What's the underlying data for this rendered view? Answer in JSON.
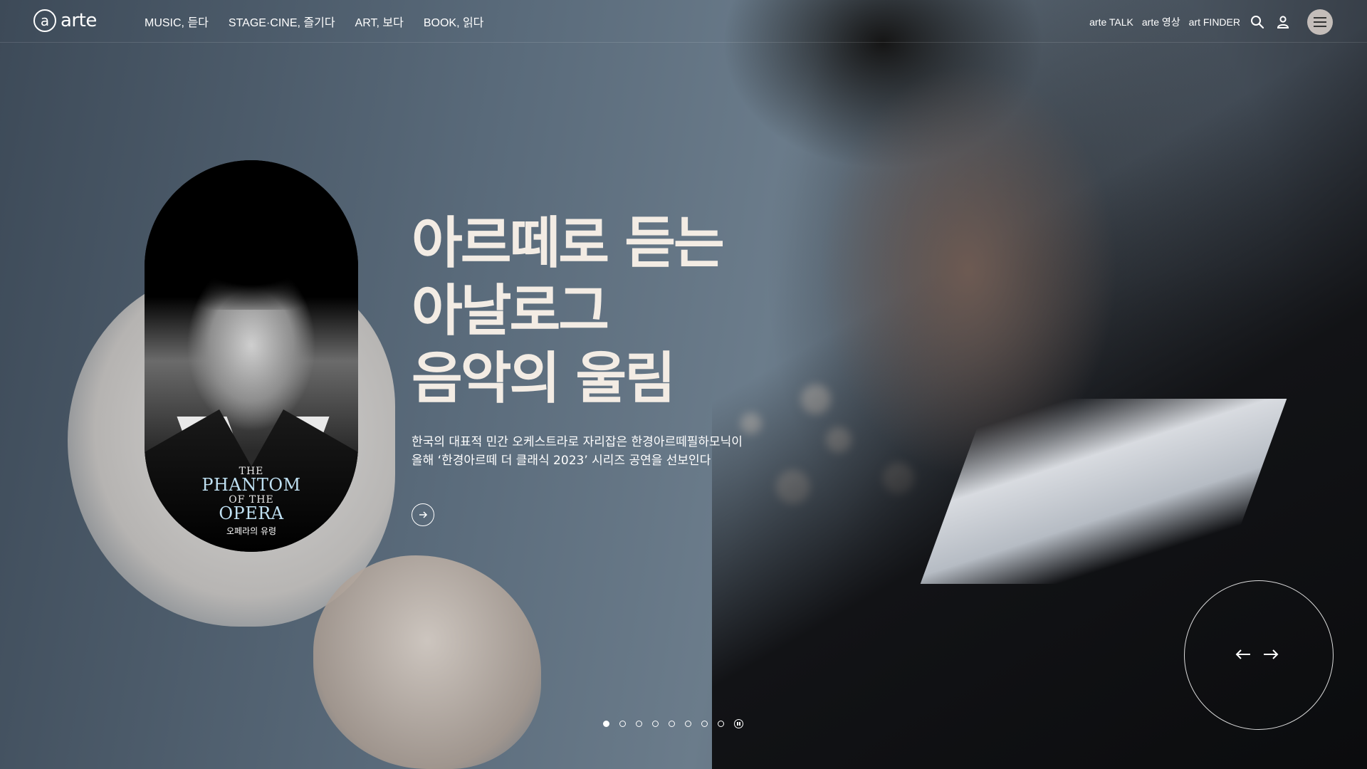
{
  "header": {
    "logo": {
      "mark": "a",
      "text": "arte"
    },
    "nav": [
      {
        "label": "MUSIC, 듣다"
      },
      {
        "label": "STAGE·CINE, 즐기다"
      },
      {
        "label": "ART, 보다"
      },
      {
        "label": "BOOK, 읽다"
      }
    ],
    "utility": [
      {
        "label": "arte TALK"
      },
      {
        "label": "arte 영상"
      },
      {
        "label": "art FINDER"
      }
    ],
    "icons": {
      "search": "search-icon",
      "user": "user-icon",
      "menu": "menu-icon"
    }
  },
  "hero": {
    "poster": {
      "line1": "THE",
      "line2": "PHANTOM",
      "line3": "OF THE",
      "line4": "OPERA",
      "subtitle": "오페라의 유령"
    },
    "headline": [
      "아르떼로 듣는",
      "아날로그",
      "음악의 울림"
    ],
    "description": [
      "한국의 대표적 민간 오케스트라로 자리잡은 한경아르떼필하모닉이",
      "올해 ‘한경아르떼 더 클래식 2023’ 시리즈 공연을 선보인다"
    ],
    "more_icon": "arrow-right-circle-icon"
  },
  "slider": {
    "total_slides": 8,
    "active_index": 0,
    "pause_icon": "pause-icon",
    "prev_icon": "arrow-left-icon",
    "next_icon": "arrow-right-icon"
  },
  "colors": {
    "headline": "#f3ece4",
    "poster_title": "#bfe0f2",
    "menu_button": "#dcd2cd"
  }
}
